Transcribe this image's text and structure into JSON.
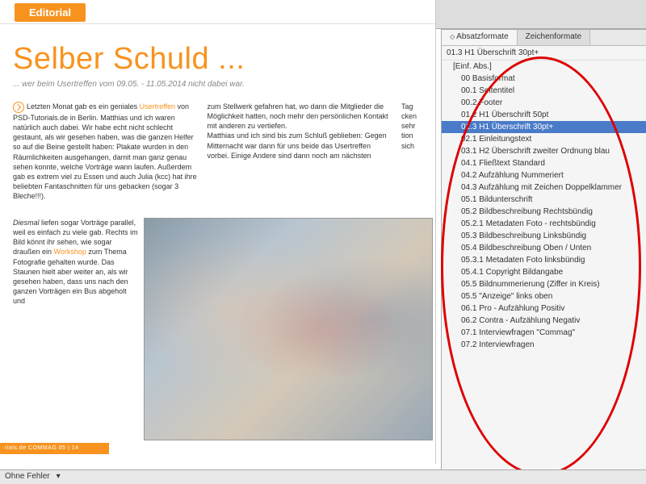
{
  "editorial": {
    "tab": "Editorial",
    "headline": "Selber Schuld ...",
    "subhead": "... wer beim Usertreffen vom 09.05. - 11.05.2014 nicht dabei war.",
    "col1_a": "Letzten Monat gab es ein geniales ",
    "link1": "Usertreffen",
    "col1_b": " von PSD-Tutorials.de in Berlin. Matthias und ich waren natürlich auch dabei. Wir habe echt nicht schlecht gestaunt, als wir gesehen haben, was die ganzen Helfer so auf die Beine gestellt haben: Plakate wurden in den Räumlichkeiten ausgehangen, damit man ganz genau sehen konnte, welche Vorträge wann laufen. Außerdem gab es extrem viel zu Essen und auch Julia (kcc) hat ihre beliebten Fantaschnitten für uns gebacken (sogar 3 Bleche!!!).",
    "col1_c_ital": "Diesmal",
    "col1_c": " liefen sogar Vorträge parallel, weil es einfach zu viele gab. Rechts im Bild könnt ihr sehen, wie sogar draußen ein ",
    "link2": "Workshop",
    "col1_d": " zum Thema Fotografie gehalten wurde. Das Staunen hielt aber weiter an, als wir gesehen haben, dass uns nach den ganzen Vorträgen ein Bus abgeholt und",
    "col2": "zum Stellwerk gefahren hat, wo dann die Mitglieder die Möglichkeit hatten, noch mehr den persönlichen Kontakt mit anderen zu vertiefen.\nMatthias und ich sind bis zum Schluß geblieben: Gegen Mitternacht war dann für uns beide das Usertreffen vorbei. Einige Andere sind dann noch am nächsten",
    "col3": "Tag\ncken\nsehr\ntion\nsich",
    "footer": "rials.de  COMMAG 05 | 14"
  },
  "panel": {
    "tab_para": "Absatzformate",
    "tab_char": "Zeichenformate",
    "current": "01.3 H1 Überschrift 30pt+",
    "items": [
      {
        "l": "[Einf. Abs.]",
        "lvl": 0
      },
      {
        "l": "00 Basisformat",
        "lvl": 1
      },
      {
        "l": "00.1 Seitentitel",
        "lvl": 1
      },
      {
        "l": "00.2 Footer",
        "lvl": 1
      },
      {
        "l": "01.2 H1 Überschrift 50pt",
        "lvl": 1
      },
      {
        "l": "01.3 H1 Überschrift 30pt+",
        "lvl": 1,
        "sel": true
      },
      {
        "l": "02.1 Einleitungstext",
        "lvl": 1
      },
      {
        "l": "03.1 H2 Überschrift zweiter Ordnung blau",
        "lvl": 1
      },
      {
        "l": "04.1 Fließtext Standard",
        "lvl": 1
      },
      {
        "l": "04.2 Aufzählung Nummeriert",
        "lvl": 1
      },
      {
        "l": "04.3 Aufzählung mit Zeichen Doppelklammer",
        "lvl": 1
      },
      {
        "l": "05.1 Bildunterschrift",
        "lvl": 1
      },
      {
        "l": "05.2 Bildbeschreibung Rechtsbündig",
        "lvl": 1
      },
      {
        "l": "05.2.1 Metadaten Foto - rechtsbündig",
        "lvl": 1
      },
      {
        "l": "05.3 Bildbeschreibung Linksbündig",
        "lvl": 1
      },
      {
        "l": "05.4 Bildbeschreibung Oben / Unten",
        "lvl": 1
      },
      {
        "l": "05.3.1 Metadaten Foto linksbündig",
        "lvl": 1
      },
      {
        "l": "05.4.1 Copyright Bildangabe",
        "lvl": 1
      },
      {
        "l": "05.5 Bildnummerierung (Ziffer in Kreis)",
        "lvl": 1
      },
      {
        "l": "05.5 \"Anzeige\" links oben",
        "lvl": 1
      },
      {
        "l": "06.1 Pro - Aufzählung Positiv",
        "lvl": 1
      },
      {
        "l": "06.2 Contra - Aufzählung Negativ",
        "lvl": 1
      },
      {
        "l": "07.1 Interviewfragen \"Commag\"",
        "lvl": 1
      },
      {
        "l": "07.2 Interviewfragen",
        "lvl": 1
      }
    ]
  },
  "status": {
    "errors": "Ohne Fehler"
  }
}
